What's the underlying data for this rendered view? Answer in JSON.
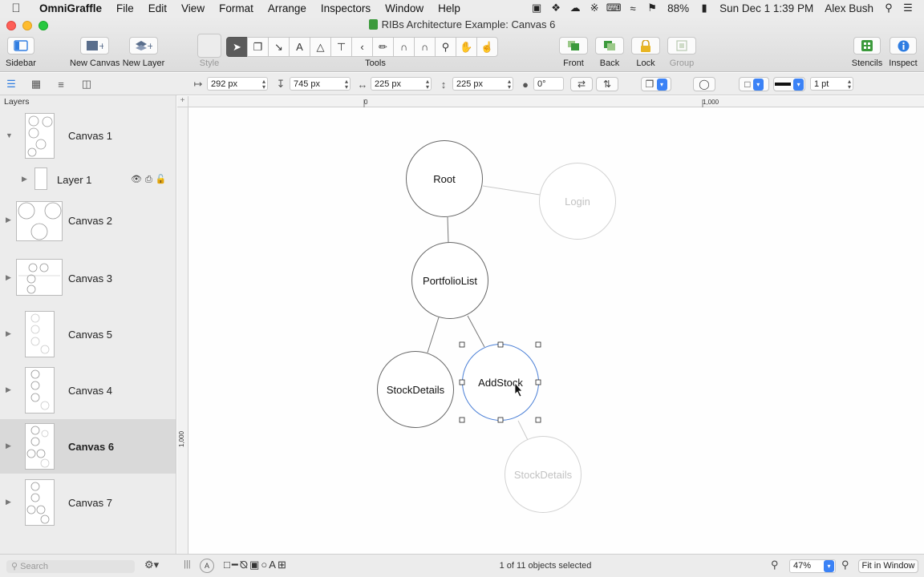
{
  "menubar": {
    "app_name": "OmniGraffle",
    "items": [
      "File",
      "Edit",
      "View",
      "Format",
      "Arrange",
      "Inspectors",
      "Window",
      "Help"
    ],
    "battery": "88%",
    "datetime": "Sun Dec 1  1:39 PM",
    "user": "Alex Bush"
  },
  "window": {
    "title": "RIBs Architecture Example: Canvas 6"
  },
  "toolbar": {
    "sidebar_label": "Sidebar",
    "new_canvas_label": "New Canvas",
    "new_layer_label": "New Layer",
    "style_label": "Style",
    "tools_label": "Tools",
    "front_label": "Front",
    "back_label": "Back",
    "lock_label": "Lock",
    "group_label": "Group",
    "stencils_label": "Stencils",
    "inspect_label": "Inspect",
    "tools": [
      "pointer-icon",
      "shape-icon",
      "line-icon",
      "text-icon",
      "pen-icon",
      "diagram-icon",
      "back-icon",
      "style-brush-icon",
      "magnet-icon",
      "connect-icon",
      "zoom-icon",
      "hand-icon",
      "browse-icon"
    ]
  },
  "geometry_bar": {
    "x_value": "292 px",
    "y_value": "745 px",
    "width_value": "225 px",
    "height_value": "225 px",
    "rotation_value": "0°",
    "stroke_width_value": "1 pt"
  },
  "sidebar": {
    "header": "Layers",
    "canvases": [
      {
        "label": "Canvas 1",
        "expanded": true,
        "selected": false
      },
      {
        "label": "Layer 1",
        "is_layer": true
      },
      {
        "label": "Canvas 2",
        "expanded": false,
        "selected": false
      },
      {
        "label": "Canvas 3",
        "expanded": false,
        "selected": false
      },
      {
        "label": "Canvas 5",
        "expanded": false,
        "selected": false
      },
      {
        "label": "Canvas 4",
        "expanded": false,
        "selected": false
      },
      {
        "label": "Canvas 6",
        "expanded": false,
        "selected": true
      },
      {
        "label": "Canvas 7",
        "expanded": false,
        "selected": false
      }
    ]
  },
  "rulers": {
    "top_zero": "0",
    "top_thousand": "1,000",
    "left_thousand": "1,000"
  },
  "diagram": {
    "nodes": [
      {
        "label": "Root",
        "faded": false,
        "selected": false
      },
      {
        "label": "Login",
        "faded": true,
        "selected": false
      },
      {
        "label": "PortfolioList",
        "faded": false,
        "selected": false
      },
      {
        "label": "StockDetails",
        "faded": false,
        "selected": false
      },
      {
        "label": "AddStock",
        "faded": false,
        "selected": true
      },
      {
        "label": "StockDetails",
        "faded": true,
        "selected": false
      }
    ],
    "edge_color": "#777777",
    "faded_color": "#cccccc",
    "selection_color": "#4a7fd6"
  },
  "bottombar": {
    "search_placeholder": "Search",
    "selection_status": "1 of 11 objects selected",
    "zoom": "47%",
    "fit_button": "Fit in Window"
  },
  "colors": {
    "tool_active": "#5b5b5b",
    "accent_blue": "#3b82f6",
    "stencils_green": "#3c9a3c",
    "inspect_blue": "#2f7de1"
  }
}
